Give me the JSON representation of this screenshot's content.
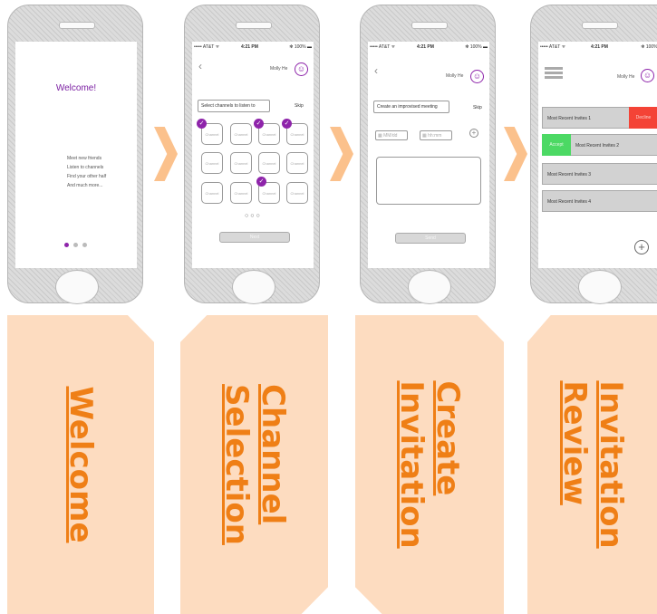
{
  "status": {
    "carrier": "••••• AT&T ᯤ",
    "time": "4:21 PM",
    "battery": "✻ 100% ▬"
  },
  "user": {
    "name": "Molly He"
  },
  "screens": {
    "welcome": {
      "title": "Welcome!",
      "lines": [
        "Meet new friends",
        "Listen to channels",
        "Find your other half",
        "And much more..."
      ]
    },
    "channels": {
      "prompt": "Select channels to listen to",
      "skip": "Skip",
      "tile_label": "Channel",
      "next": "Next"
    },
    "create": {
      "prompt": "Create an improvised meeting",
      "skip": "Skip",
      "field1": "MM/dd",
      "field2": "hh:mm",
      "send": "Send"
    },
    "review": {
      "invites": [
        "Most Recent Invites 1",
        "Most Recent Invites 2",
        "Most Recent Invites 3",
        "Most Recent Invites 4"
      ],
      "decline": "Decline",
      "accept": "Accept"
    }
  },
  "cards": {
    "welcome": "Welcome",
    "channel_selection": "Channel\nSelection",
    "create_invitation": "Create\nInvitation",
    "invitation_review": "Invitation\nReview"
  },
  "colors": {
    "accent": "#8e24aa",
    "orange": "#ef7f16",
    "card_bg": "#fddcc0",
    "arrow": "#fbc18c",
    "decline": "#f44336",
    "accept": "#4cd964"
  }
}
